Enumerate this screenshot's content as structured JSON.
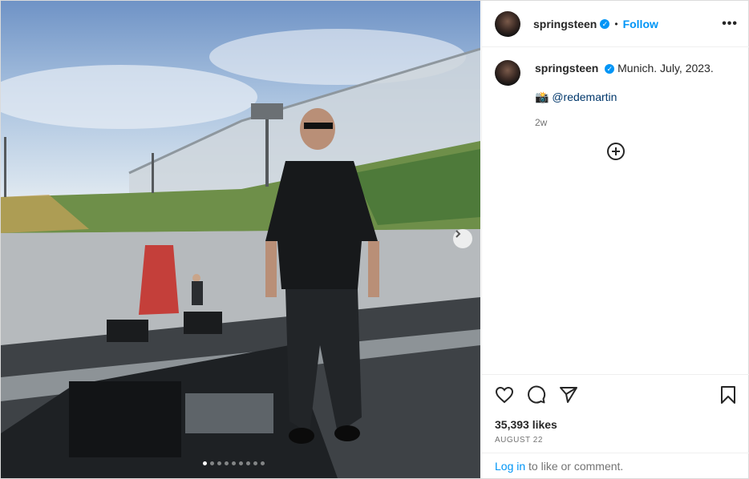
{
  "post": {
    "username": "springsteen",
    "verified_glyph": "✓",
    "separator": "•",
    "follow_label": "Follow",
    "more_label": "•••",
    "caption": "Munich. July, 2023.",
    "credit_emoji": "📸",
    "credit_mention": "@redemartin",
    "time_ago": "2w",
    "likes": "35,393 likes",
    "date": "AUGUST 22",
    "login_link": "Log in",
    "login_rest": " to like or comment."
  },
  "carousel": {
    "slides": 9,
    "active_index": 0
  },
  "icons": {
    "verified": "verified-badge-icon",
    "more": "more-options-icon",
    "add": "add-circle-icon",
    "like": "heart-icon",
    "comment": "comment-icon",
    "share": "send-icon",
    "save": "bookmark-icon",
    "next": "chevron-right-icon"
  },
  "colors": {
    "accent": "#0095f6",
    "text": "#262626",
    "muted": "#737373",
    "mention": "#00376b"
  }
}
